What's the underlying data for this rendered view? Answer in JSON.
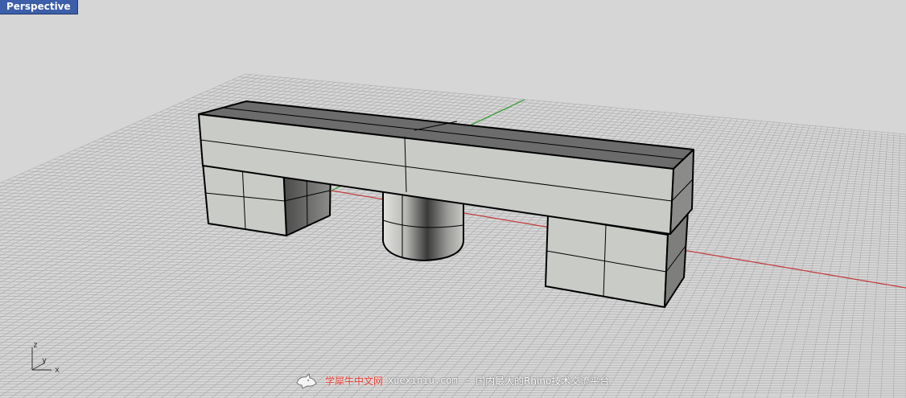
{
  "viewport": {
    "label": "Perspective",
    "axes": {
      "z": "z",
      "y": "y",
      "x": "x"
    }
  },
  "colors": {
    "background": "#d6d6d6",
    "grid": "#a9a9a9",
    "x_axis": "#c23a3a",
    "y_axis": "#2e9a2e",
    "surface_light": "#c9cbc7",
    "surface_dark": "#6c6c6c",
    "edge": "#000000"
  },
  "watermark": {
    "site_name": "学犀牛中文网",
    "domain": "xuexiniu.com",
    "separator": "-",
    "tagline": "国内最大的Rhino技术交流平台",
    "logo_icon": "rhino-logo-icon"
  }
}
